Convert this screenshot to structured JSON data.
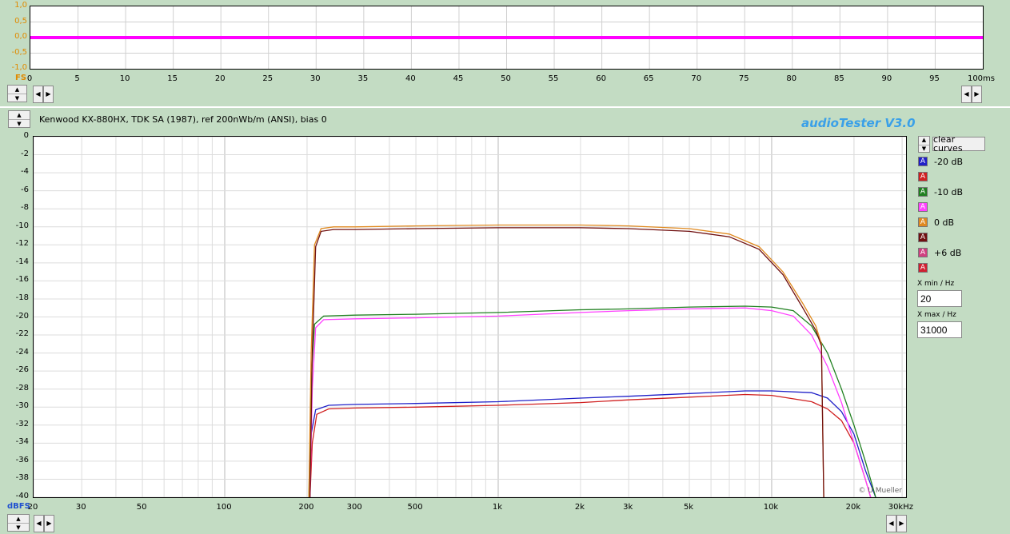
{
  "top_panel": {
    "y_ticks": [
      "1,0",
      "0,5",
      "0,0",
      "-0,5",
      "-1,0"
    ],
    "y_unit": "FS",
    "x_ticks": [
      "0",
      "5",
      "10",
      "15",
      "20",
      "25",
      "30",
      "35",
      "40",
      "45",
      "50",
      "55",
      "60",
      "65",
      "70",
      "75",
      "80",
      "85",
      "90",
      "95",
      "100ms"
    ],
    "trace_color": "#ff00ff"
  },
  "main_panel": {
    "title": "Kenwood KX-880HX, TDK SA (1987), ref 200nWb/m (ANSI), bias 0",
    "brand": "audioTester  V3.0",
    "credit": "© U.Mueller",
    "y_unit": "dBFS",
    "clear_button": "clear curves",
    "xmin_label": "X min / Hz",
    "xmin_value": "20",
    "xmax_label": "X max / Hz",
    "xmax_value": "31000"
  },
  "legend": [
    {
      "label": "-20 dB",
      "color": "#2020c8"
    },
    {
      "label": "",
      "color": "#d02020"
    },
    {
      "label": "-10 dB",
      "color": "#208020"
    },
    {
      "label": "",
      "color": "#ff40ff"
    },
    {
      "label": "0 dB",
      "color": "#e08a20"
    },
    {
      "label": "",
      "color": "#701010"
    },
    {
      "label": "+6 dB",
      "color": "#d04080"
    },
    {
      "label": "",
      "color": "#d02030"
    }
  ],
  "chart_data": {
    "type": "line",
    "title": "Kenwood KX-880HX, TDK SA (1987), ref 200nWb/m (ANSI), bias 0",
    "xlabel": "",
    "ylabel": "dBFS",
    "xscale": "log",
    "xlim": [
      20,
      31000
    ],
    "ylim": [
      -40,
      0
    ],
    "grid": true,
    "legend_position": "right",
    "x_tick_labels": [
      "20",
      "30",
      "50",
      "100",
      "200",
      "300",
      "500",
      "1k",
      "2k",
      "3k",
      "5k",
      "10k",
      "20k",
      "30kHz"
    ],
    "x_tick_values": [
      20,
      30,
      50,
      100,
      200,
      300,
      500,
      1000,
      2000,
      3000,
      5000,
      10000,
      20000,
      30000
    ],
    "y_tick_values": [
      0,
      -2,
      -4,
      -6,
      -8,
      -10,
      -12,
      -14,
      -16,
      -18,
      -20,
      -22,
      -24,
      -26,
      -28,
      -30,
      -32,
      -34,
      -36,
      -38,
      -40
    ],
    "series": [
      {
        "name": "-20 dB",
        "color": "#2020c8",
        "points": [
          [
            203,
            -40
          ],
          [
            207,
            -33
          ],
          [
            215,
            -30.3
          ],
          [
            240,
            -29.8
          ],
          [
            300,
            -29.7
          ],
          [
            500,
            -29.6
          ],
          [
            1000,
            -29.4
          ],
          [
            2000,
            -29
          ],
          [
            3000,
            -28.8
          ],
          [
            5000,
            -28.5
          ],
          [
            8000,
            -28.2
          ],
          [
            10000,
            -28.2
          ],
          [
            14000,
            -28.4
          ],
          [
            16000,
            -29
          ],
          [
            18000,
            -30.5
          ],
          [
            20000,
            -33
          ],
          [
            22000,
            -37
          ],
          [
            24000,
            -40
          ]
        ]
      },
      {
        "name": "",
        "color": "#d02020",
        "points": [
          [
            205,
            -40
          ],
          [
            209,
            -34
          ],
          [
            217,
            -30.8
          ],
          [
            240,
            -30.2
          ],
          [
            300,
            -30.1
          ],
          [
            500,
            -30
          ],
          [
            1000,
            -29.8
          ],
          [
            2000,
            -29.5
          ],
          [
            3000,
            -29.2
          ],
          [
            5000,
            -28.9
          ],
          [
            8000,
            -28.6
          ],
          [
            10000,
            -28.7
          ],
          [
            14000,
            -29.4
          ],
          [
            16000,
            -30.2
          ],
          [
            18000,
            -31.5
          ],
          [
            20000,
            -34
          ],
          [
            22000,
            -38
          ],
          [
            23000,
            -40
          ]
        ]
      },
      {
        "name": "-10 dB",
        "color": "#208020",
        "points": [
          [
            203,
            -40
          ],
          [
            207,
            -27
          ],
          [
            213,
            -20.8
          ],
          [
            230,
            -19.9
          ],
          [
            300,
            -19.8
          ],
          [
            500,
            -19.7
          ],
          [
            1000,
            -19.5
          ],
          [
            2000,
            -19.2
          ],
          [
            3000,
            -19.1
          ],
          [
            5000,
            -18.9
          ],
          [
            8000,
            -18.8
          ],
          [
            10000,
            -18.9
          ],
          [
            12000,
            -19.3
          ],
          [
            14000,
            -21
          ],
          [
            16000,
            -24
          ],
          [
            18000,
            -28
          ],
          [
            20000,
            -32
          ],
          [
            22000,
            -36
          ],
          [
            24000,
            -40
          ]
        ]
      },
      {
        "name": "",
        "color": "#ff40ff",
        "points": [
          [
            205,
            -40
          ],
          [
            209,
            -28
          ],
          [
            215,
            -21.2
          ],
          [
            230,
            -20.3
          ],
          [
            300,
            -20.2
          ],
          [
            500,
            -20.1
          ],
          [
            1000,
            -19.9
          ],
          [
            2000,
            -19.5
          ],
          [
            3000,
            -19.3
          ],
          [
            5000,
            -19.1
          ],
          [
            8000,
            -19
          ],
          [
            10000,
            -19.3
          ],
          [
            12000,
            -19.9
          ],
          [
            14000,
            -22
          ],
          [
            16000,
            -25.5
          ],
          [
            18000,
            -29.5
          ],
          [
            20000,
            -34
          ],
          [
            22000,
            -38
          ],
          [
            23000,
            -40
          ]
        ]
      },
      {
        "name": "0 dB",
        "color": "#e08a20",
        "points": [
          [
            203,
            -40
          ],
          [
            207,
            -24
          ],
          [
            213,
            -12
          ],
          [
            225,
            -10.2
          ],
          [
            250,
            -10
          ],
          [
            300,
            -10
          ],
          [
            500,
            -9.9
          ],
          [
            1000,
            -9.8
          ],
          [
            2000,
            -9.8
          ],
          [
            3000,
            -9.9
          ],
          [
            5000,
            -10.2
          ],
          [
            7000,
            -10.8
          ],
          [
            9000,
            -12.2
          ],
          [
            11000,
            -15
          ],
          [
            13000,
            -18.5
          ],
          [
            14500,
            -21
          ],
          [
            15200,
            -23
          ],
          [
            15500,
            -40
          ]
        ]
      },
      {
        "name": "",
        "color": "#701010",
        "points": [
          [
            205,
            -40
          ],
          [
            209,
            -24
          ],
          [
            215,
            -12.2
          ],
          [
            225,
            -10.5
          ],
          [
            250,
            -10.3
          ],
          [
            300,
            -10.3
          ],
          [
            500,
            -10.2
          ],
          [
            1000,
            -10.1
          ],
          [
            2000,
            -10.1
          ],
          [
            3000,
            -10.2
          ],
          [
            5000,
            -10.5
          ],
          [
            7000,
            -11.1
          ],
          [
            9000,
            -12.5
          ],
          [
            11000,
            -15.3
          ],
          [
            13000,
            -19
          ],
          [
            14500,
            -21.5
          ],
          [
            15200,
            -23.2
          ],
          [
            15500,
            -40
          ]
        ]
      }
    ]
  }
}
